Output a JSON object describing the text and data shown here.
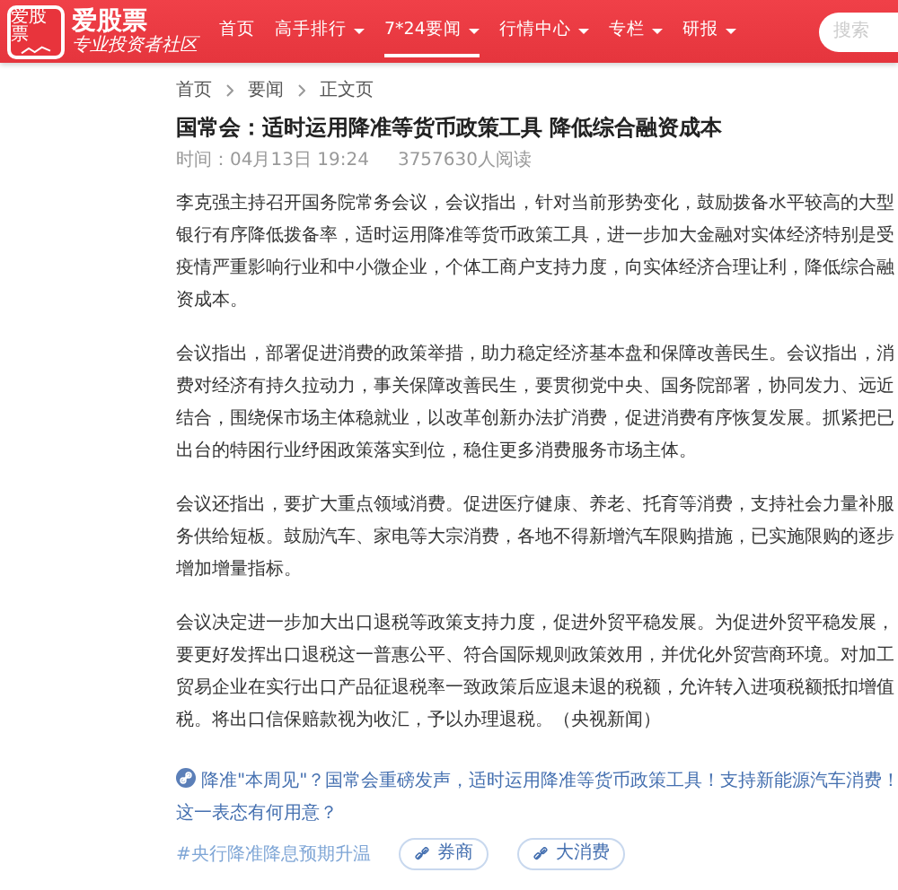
{
  "header": {
    "logo_icon_text": "爱股票",
    "logo_text": "爱股票",
    "slogan": "专业投资者社区",
    "nav": [
      {
        "label": "首页",
        "selected": false,
        "dropdown": false
      },
      {
        "label": "高手排行",
        "selected": false,
        "dropdown": true
      },
      {
        "label": "7*24要闻",
        "selected": true,
        "dropdown": true
      },
      {
        "label": "行情中心",
        "selected": false,
        "dropdown": true
      },
      {
        "label": "专栏",
        "selected": false,
        "dropdown": true
      },
      {
        "label": "研报",
        "selected": false,
        "dropdown": true
      }
    ],
    "search": {
      "placeholder": "搜索"
    }
  },
  "breadcrumb": [
    "首页",
    "要闻",
    "正文页"
  ],
  "article": {
    "title": "国常会：适时运用降准等货币政策工具 降低综合融资成本",
    "meta": [
      "时间：04月13日 19:24",
      "3757630人阅读"
    ],
    "paragraphs": [
      "李克强主持召开国务院常务会议，会议指出，针对当前形势变化，鼓励拨备水平较高的大型银行有序降低拨备率，适时运用降准等货币政策工具，进一步加大金融对实体经济特别是受疫情严重影响行业和中小微企业，个体工商户支持力度，向实体经济合理让利，降低综合融资成本。",
      "会议指出，部署促进消费的政策举措，助力稳定经济基本盘和保障改善民生。会议指出，消费对经济有持久拉动力，事关保障改善民生，要贯彻党中央、国务院部署，协同发力、远近结合，围绕保市场主体稳就业，以改革创新办法扩消费，促进消费有序恢复发展。抓紧把已出台的特困行业纾困政策落实到位，稳住更多消费服务市场主体。",
      "会议还指出，要扩大重点领域消费。促进医疗健康、养老、托育等消费，支持社会力量补服务供给短板。鼓励汽车、家电等大宗消费，各地不得新增汽车限购措施，已实施限购的逐步增加增量指标。",
      "会议决定进一步加大出口退税等政策支持力度，促进外贸平稳发展。为促进外贸平稳发展，要更好发挥出口退税这一普惠公平、符合国际规则政策效用，并优化外贸营商环境。对加工贸易企业在实行出口产品征退税率一致政策后应退未退的税额，允许转入进项税额抵扣增值税。将出口信保赔款视为收汇，予以办理退税。（央视新闻）"
    ]
  },
  "related": {
    "text": "降准\"本周见\"？国常会重磅发声，适时运用降准等货币政策工具！支持新能源汽车消费！这一表态有何用意？"
  },
  "tags": [
    {
      "kind": "topic",
      "label": "#央行降准降息预期升温"
    },
    {
      "kind": "pill",
      "label": "券商"
    },
    {
      "kind": "pill",
      "label": "大消费"
    }
  ]
}
